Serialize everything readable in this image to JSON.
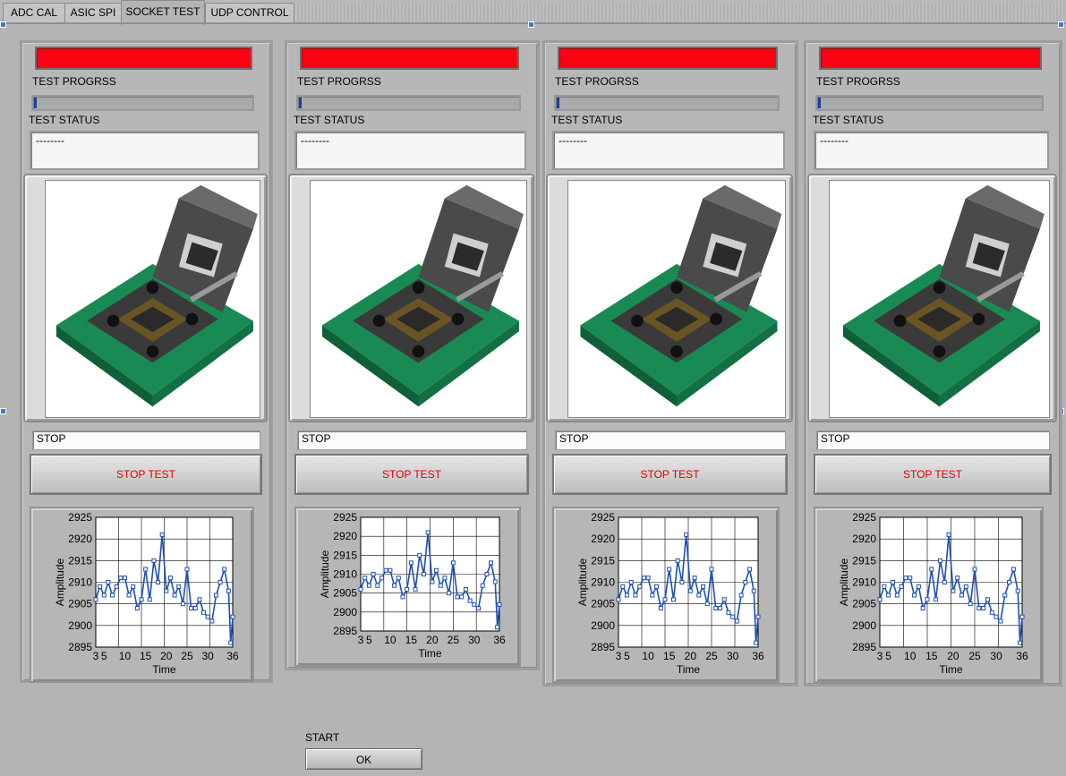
{
  "tabs": [
    {
      "label": "ADC CAL"
    },
    {
      "label": "ASIC SPI"
    },
    {
      "label": "SOCKET TEST",
      "active": true
    },
    {
      "label": "UDP CONTROL"
    }
  ],
  "sockets": [
    {
      "progress_label": "TEST PROGRSS",
      "progress": 0.01,
      "status_label": "TEST STATUS",
      "status_value": "--------",
      "stop_field": "STOP",
      "stop_button": "STOP TEST"
    },
    {
      "progress_label": "TEST PROGRSS",
      "progress": 0.01,
      "status_label": "TEST STATUS",
      "status_value": "--------",
      "stop_field": "STOP",
      "stop_button": "STOP TEST"
    },
    {
      "progress_label": "TEST PROGRSS",
      "progress": 0.01,
      "status_label": "TEST STATUS",
      "status_value": "--------",
      "stop_field": "STOP",
      "stop_button": "STOP TEST"
    },
    {
      "progress_label": "TEST PROGRSS",
      "progress": 0.01,
      "status_label": "TEST STATUS",
      "status_value": "--------",
      "stop_field": "STOP",
      "stop_button": "STOP TEST"
    }
  ],
  "chart_data": {
    "type": "line",
    "xlabel": "Time",
    "ylabel": "Amplitude",
    "xlim": [
      3,
      36
    ],
    "ylim": [
      2895,
      2925
    ],
    "x_tick_labels": [
      "3",
      "5",
      "10",
      "15",
      "20",
      "25",
      "30",
      "36"
    ],
    "y_tick_labels": [
      "2925",
      "2920",
      "2915",
      "2910",
      "2905",
      "2900",
      "2895"
    ],
    "grid": true,
    "x": [
      3,
      4,
      5,
      6,
      7,
      8,
      9,
      10,
      11,
      12,
      13,
      14,
      15,
      16,
      17,
      18,
      19,
      20,
      21,
      22,
      23,
      24,
      25,
      26,
      27,
      28,
      29,
      30,
      31,
      32,
      33,
      34,
      35,
      35.5,
      36
    ],
    "values": [
      2906,
      2909,
      2907,
      2910,
      2907,
      2909,
      2911,
      2911,
      2907,
      2909,
      2904,
      2906,
      2913,
      2906,
      2915,
      2910,
      2921,
      2908,
      2911,
      2907,
      2909,
      2905,
      2913,
      2904,
      2904,
      2906,
      2903,
      2902,
      2901,
      2907,
      2910,
      2913,
      2908,
      2896,
      2902
    ]
  },
  "start": {
    "label": "START",
    "button": "OK"
  },
  "colors": {
    "led": "#ff0013",
    "stop_text": "#e00000",
    "plot_line": "#1f4fb4"
  }
}
